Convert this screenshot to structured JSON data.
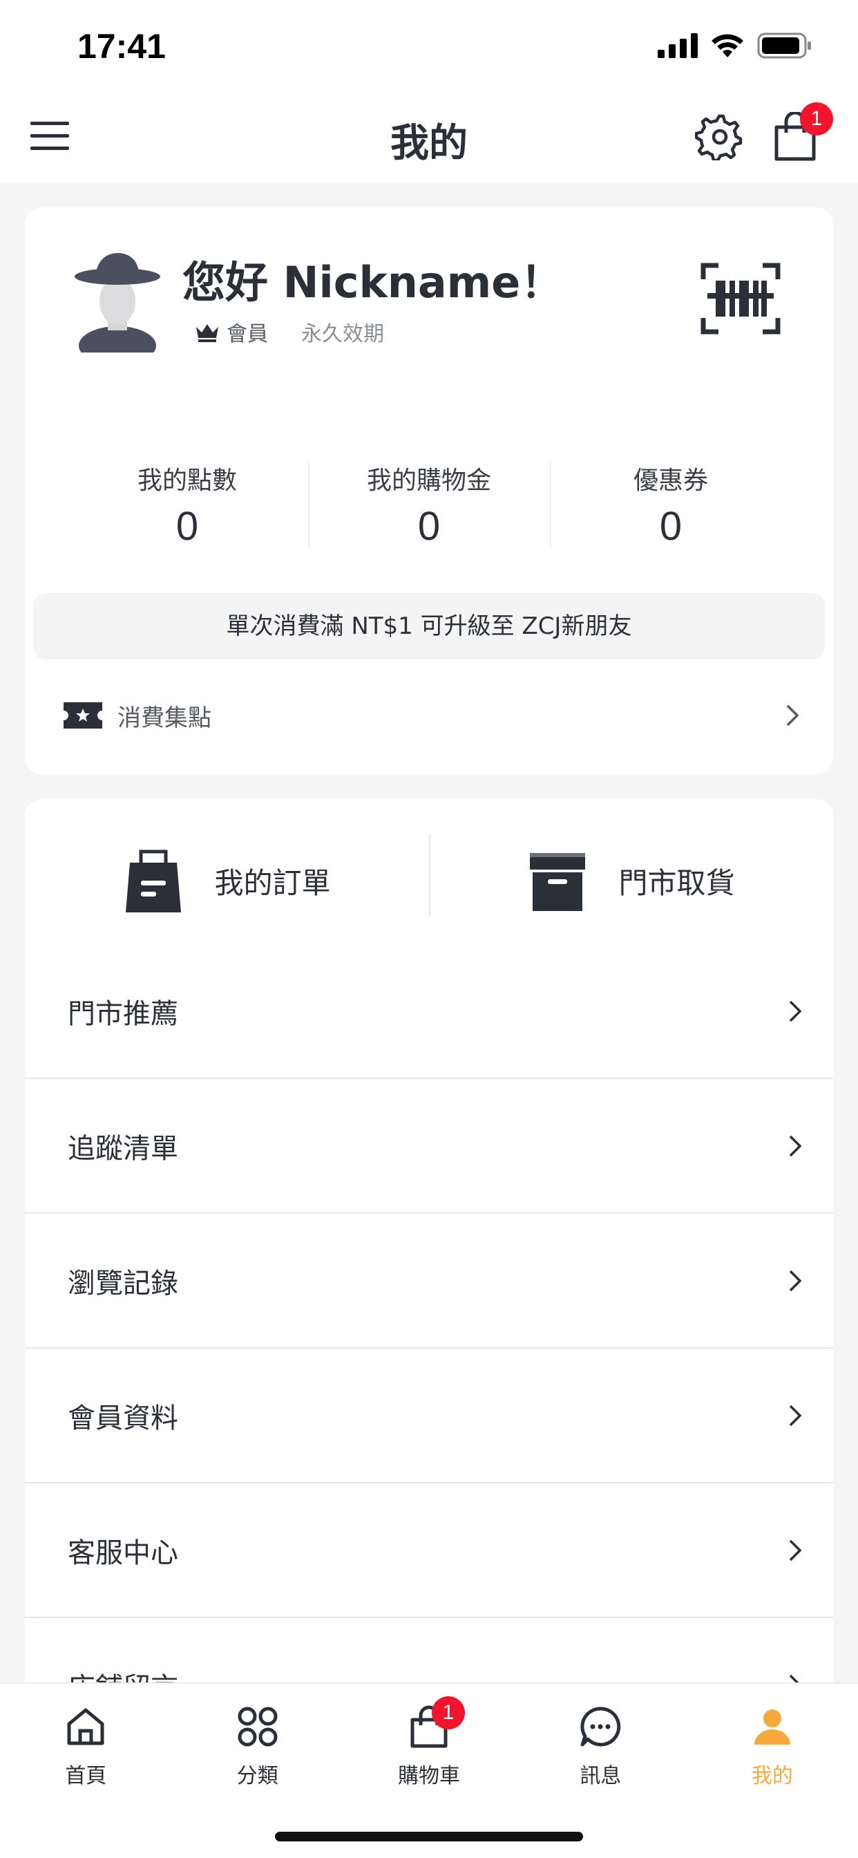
{
  "status_bar": {
    "time": "17:41"
  },
  "nav": {
    "title": "我的",
    "cart_badge": "1"
  },
  "profile": {
    "greeting": "您好 Nickname！",
    "member_level": "會員",
    "validity": "永久效期"
  },
  "stats": [
    {
      "label": "我的點數",
      "value": "0"
    },
    {
      "label": "我的購物金",
      "value": "0"
    },
    {
      "label": "優惠券",
      "value": "0"
    }
  ],
  "upgrade_text": "單次消費滿 NT$1 可升級至 ZCJ新朋友",
  "points_collect": "消費集點",
  "quick_actions": [
    {
      "label": "我的訂單",
      "icon": "shopping-bag-icon"
    },
    {
      "label": "門市取貨",
      "icon": "archive-box-icon"
    }
  ],
  "menu": [
    {
      "label": "門市推薦"
    },
    {
      "label": "追蹤清單"
    },
    {
      "label": "瀏覽記錄"
    },
    {
      "label": "會員資料"
    },
    {
      "label": "客服中心"
    },
    {
      "label": "店舖留言"
    }
  ],
  "tabs": [
    {
      "label": "首頁",
      "icon": "home-icon"
    },
    {
      "label": "分類",
      "icon": "category-grid-icon"
    },
    {
      "label": "購物車",
      "icon": "cart-bag-icon",
      "badge": "1"
    },
    {
      "label": "訊息",
      "icon": "chat-bubble-icon"
    },
    {
      "label": "我的",
      "icon": "user-icon",
      "active": true
    }
  ],
  "colors": {
    "accent": "#f7a93b",
    "badge": "#f2152d",
    "dark_icon": "#2b2f38"
  }
}
